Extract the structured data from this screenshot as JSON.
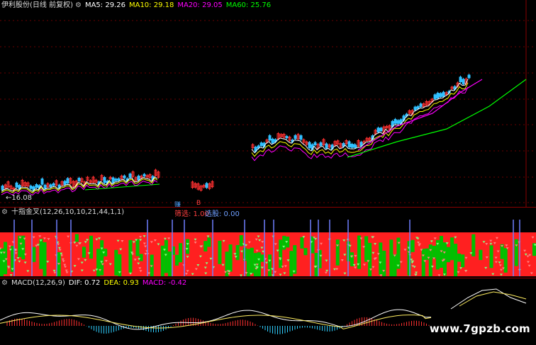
{
  "main_chart": {
    "title": "伊利股份(日线 前复权)",
    "ma5": {
      "label": "MA5: 29.26",
      "color": "#ffffff"
    },
    "ma10": {
      "label": "MA10: 29.18",
      "color": "#ffff00"
    },
    "ma20": {
      "label": "MA20: 29.05",
      "color": "#ff00ff"
    },
    "ma60": {
      "label": "MA60: 25.76",
      "color": "#00ff00"
    },
    "low_price_label": "←16.08",
    "marker_a": "赚",
    "marker_b": "B"
  },
  "indicator_panel": {
    "name": "十指金叉(12,26,10,10,21,44,1,1)",
    "filter_label": "筛选: 1.00",
    "select_label": "选股: 0.00",
    "up_color": "#ff2020",
    "down_color": "#00c000",
    "signal_color": "#6f7fff"
  },
  "macd_panel": {
    "name": "MACD(12,26,9)",
    "dif": "DIF: 0.72",
    "dea": "DEA: 0.93",
    "macd": "MACD: -0.42"
  },
  "watermark": "www.7gpzb.com"
}
